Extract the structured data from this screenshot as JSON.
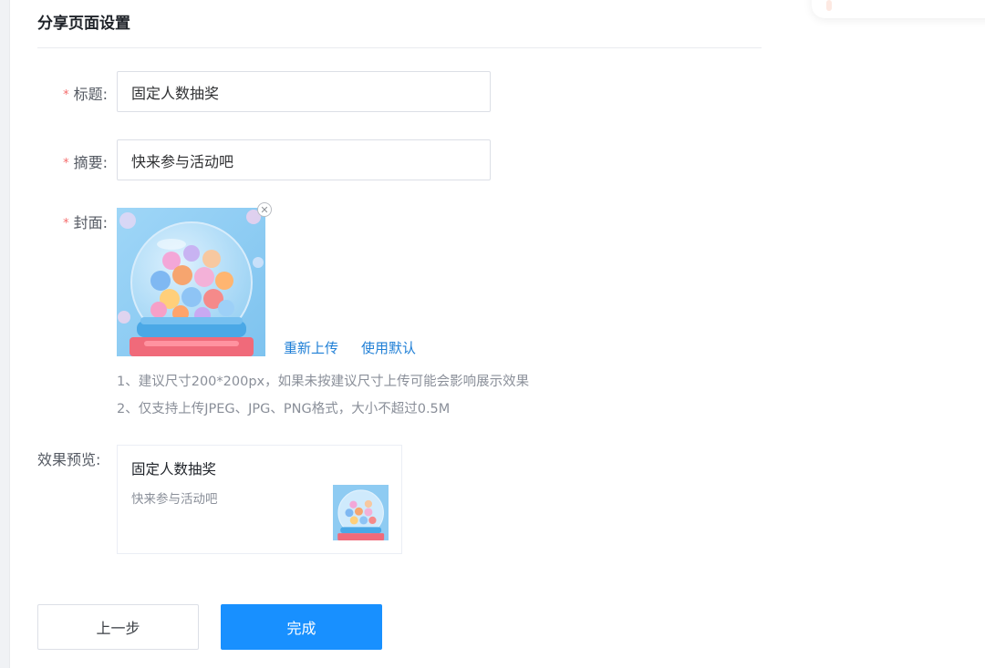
{
  "section": {
    "title": "分享页面设置"
  },
  "form": {
    "title_field": {
      "required_mark": "*",
      "label": "标题:",
      "value": "固定人数抽奖"
    },
    "summary_field": {
      "required_mark": "*",
      "label": "摘要:",
      "value": "快来参与活动吧"
    },
    "cover_field": {
      "required_mark": "*",
      "label": "封面:",
      "reupload_label": "重新上传",
      "use_default_label": "使用默认",
      "remove_icon": "close-circle-icon",
      "hints": [
        "1、建议尺寸200*200px，如果未按建议尺寸上传可能会影响展示效果",
        "2、仅支持上传JPEG、JPG、PNG格式，大小不超过0.5M"
      ]
    }
  },
  "preview": {
    "label": "效果预览:",
    "card_title": "固定人数抽奖",
    "card_summary": "快来参与活动吧"
  },
  "actions": {
    "prev_label": "上一步",
    "done_label": "完成"
  },
  "colors": {
    "primary": "#1890ff",
    "link": "#1f7fd6",
    "required": "#f56c6c"
  }
}
